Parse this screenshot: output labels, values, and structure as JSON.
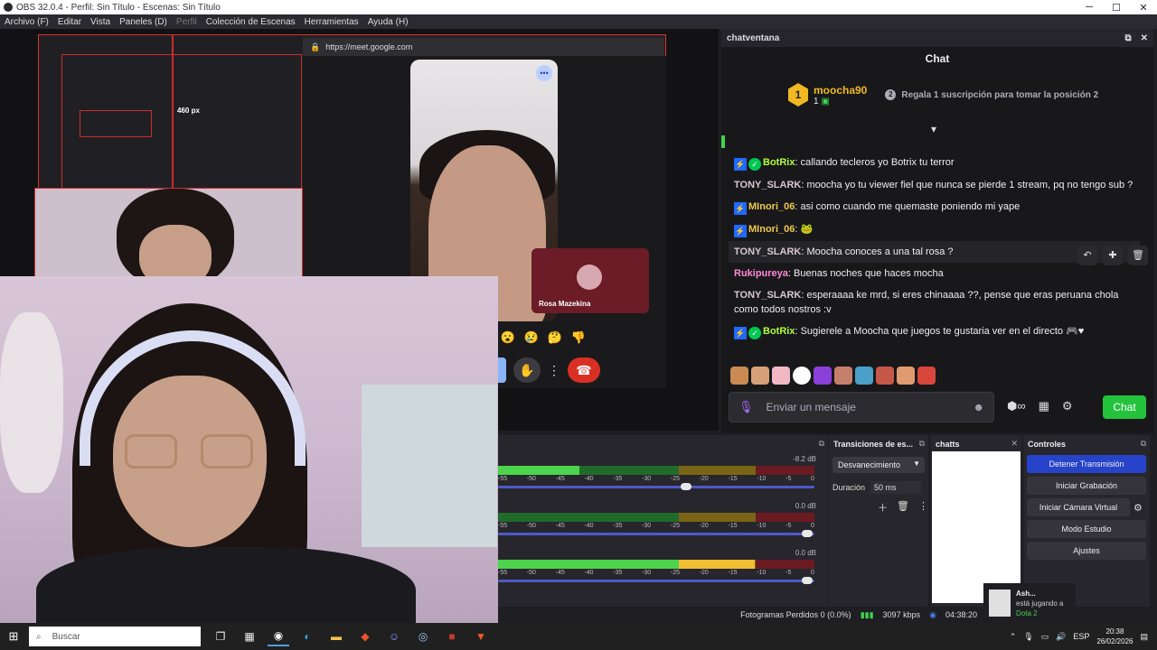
{
  "window": {
    "title": "OBS 32.0.4 - Perfil: Sin Título - Escenas: Sin Título",
    "minimize": "─",
    "maximize": "☐",
    "close": "✕"
  },
  "menu": {
    "items": [
      "Archivo (F)",
      "Editar",
      "Vista",
      "Paneles (D)",
      "Perfil",
      "Colección de Escenas",
      "Herramientas",
      "Ayuda (H)"
    ]
  },
  "preview": {
    "meet_url": "https://meet.google.com",
    "participant_name": "Rosa Mazekina",
    "size_label": "460 px",
    "reactions": [
      "😮",
      "😢",
      "🤔",
      "👎"
    ]
  },
  "chat_dock": {
    "dock_title": "chatventana",
    "chat_title": "Chat",
    "pinned": {
      "rank": "1",
      "user": "moocha90",
      "count": "1",
      "badge2": "2",
      "gift_text": "Regala 1 suscripción para tomar la posición 2"
    },
    "messages": [
      {
        "user": "BotRix",
        "color": "#b3ff3f",
        "bot": true,
        "text": "callando tecleros yo Botrix tu terror"
      },
      {
        "user": "TONY_SLARK",
        "color": "#d7c7d0",
        "bot": false,
        "text": "moocha yo tu viewer fiel que nunca se pierde 1 stream, pq no tengo sub ?"
      },
      {
        "user": "MInori_06",
        "color": "#f0c94b",
        "bot": false,
        "text": "asi como cuando me quemaste poniendo mi yape"
      },
      {
        "user": "MInori_06",
        "color": "#f0c94b",
        "bot": false,
        "text": "🐸"
      },
      {
        "user": "TONY_SLARK",
        "color": "#d7c7d0",
        "bot": false,
        "text": "Moocha conoces a una tal rosa ?"
      },
      {
        "user": "Rukipureya",
        "color": "#ff8ad8",
        "bot": false,
        "text": "Buenas noches que haces mocha"
      },
      {
        "user": "TONY_SLARK",
        "color": "#d7c7d0",
        "bot": false,
        "text": "esperaaaa ke mrd, si eres chinaaaa ??, pense que eras peruana chola como todos nostros :v"
      },
      {
        "user": "BotRix",
        "color": "#b3ff3f",
        "bot": true,
        "text": "Sugierele a Moocha que juegos te gustaria ver en el directo 🎮♥"
      }
    ],
    "input_placeholder": "Enviar un mensaje",
    "send_label": "Chat"
  },
  "mixer": {
    "channels": [
      {
        "db": "-8.2 dB",
        "level": 0.26
      },
      {
        "db": "0.0 dB",
        "level": 0.0
      },
      {
        "db": "0.0 dB",
        "level": 0.81
      }
    ],
    "ticks": [
      "-55",
      "-50",
      "-45",
      "-40",
      "-35",
      "-30",
      "-25",
      "-20",
      "-15",
      "-10",
      "-5",
      "0"
    ]
  },
  "transitions": {
    "title": "Transiciones de es...",
    "selected": "Desvanecimiento",
    "duration_label": "Duración",
    "duration_value": "50 ms"
  },
  "chatts": {
    "title": "chatts"
  },
  "controls": {
    "title": "Controles",
    "buttons": [
      "Detener Transmisión",
      "Iniciar Grabación",
      "Iniciar Cámara Virtual",
      "Modo Estudio",
      "Ajustes"
    ]
  },
  "status": {
    "dropped": "Fotogramas Perdidos 0 (0.0%)",
    "bitrate": "3097 kbps",
    "time": "04:38:20"
  },
  "notification": {
    "name": "Ash...",
    "activity": "está jugando a",
    "game": "Dota 2"
  },
  "taskbar": {
    "search_placeholder": "Buscar",
    "language": "ESP",
    "time": "20:38",
    "date": "26/02/2026"
  }
}
